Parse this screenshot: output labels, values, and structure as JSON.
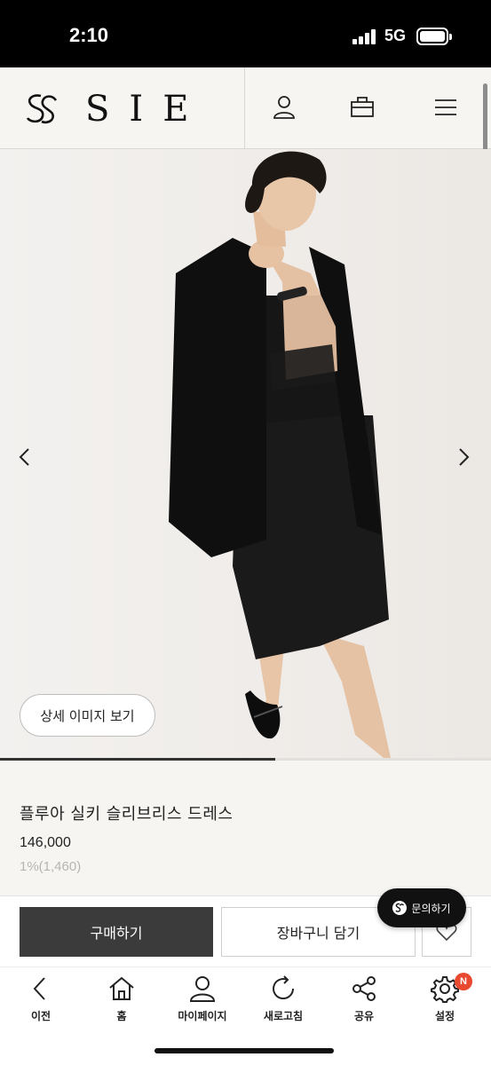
{
  "status_bar": {
    "time": "2:10",
    "network": "5G"
  },
  "header": {
    "brand": "SIE",
    "icons": [
      "logo-mark-icon",
      "user-icon",
      "shopping-bag-icon",
      "menu-icon"
    ]
  },
  "hero": {
    "detail_button_label": "상세 이미지 보기",
    "slider_progress": 0.56
  },
  "product": {
    "name": "플루아 실키 슬리브리스 드레스",
    "price": "146,000",
    "points": "1%(1,460)"
  },
  "actions": {
    "buy_label": "구매하기",
    "cart_label": "장바구니 담기",
    "inquiry_label": "문의하기"
  },
  "toolbar": {
    "items": [
      {
        "label": "이전",
        "icon": "back-arrow-icon"
      },
      {
        "label": "홈",
        "icon": "home-icon"
      },
      {
        "label": "마이페이지",
        "icon": "user-icon"
      },
      {
        "label": "새로고침",
        "icon": "refresh-icon"
      },
      {
        "label": "공유",
        "icon": "share-icon"
      },
      {
        "label": "설정",
        "icon": "settings-icon"
      }
    ],
    "settings_badge": "N"
  },
  "colors": {
    "status_bar_bg": "#000000",
    "header_bg": "#f6f5f1",
    "buy_button_bg": "#3b3b3b",
    "inquiry_bg": "#111111",
    "badge_bg": "#e8492f"
  }
}
